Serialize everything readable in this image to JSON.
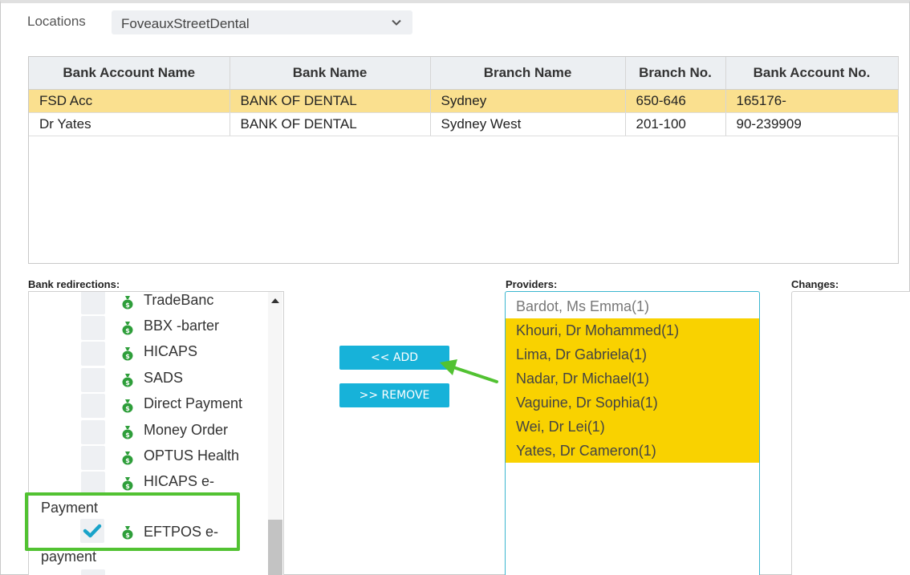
{
  "location": {
    "label": "Locations",
    "value": "FoveauxStreetDental"
  },
  "bank_table": {
    "columns": [
      "Bank Account Name",
      "Bank Name",
      "Branch Name",
      "Branch No.",
      "Bank Account No."
    ],
    "rows": [
      [
        "FSD Acc",
        "BANK OF DENTAL",
        "Sydney",
        "650-646",
        "165176-"
      ],
      [
        "Dr Yates",
        "BANK OF DENTAL",
        "Sydney West",
        "201-100",
        "90-239909"
      ]
    ],
    "selected_row": 0
  },
  "bank_redirections": {
    "label": "Bank redirections:",
    "items": [
      {
        "label": "TradeBanc",
        "icon": "money-bag-icon"
      },
      {
        "label": "BBX -barter",
        "icon": "money-bag-icon"
      },
      {
        "label": "HICAPS",
        "icon": "money-bag-icon"
      },
      {
        "label": "SADS",
        "icon": "money-bag-icon"
      },
      {
        "label": "Direct Payment",
        "icon": "money-bag-icon"
      },
      {
        "label": "Money Order",
        "icon": "money-bag-icon"
      },
      {
        "label": "OPTUS Health",
        "icon": "money-bag-icon"
      },
      {
        "label": "HICAPS e-",
        "icon": "money-bag-icon"
      }
    ],
    "hicaps_wrap": "Payment",
    "checked_item": {
      "label": "EFTPOS e-",
      "wrap": "payment",
      "checked": true
    }
  },
  "buttons": {
    "add": "<< ADD",
    "remove": ">> REMOVE"
  },
  "providers": {
    "label": "Providers:",
    "items": [
      {
        "label": "Bardot, Ms Emma(1)",
        "selected": false
      },
      {
        "label": "Khouri, Dr Mohammed(1)",
        "selected": true
      },
      {
        "label": "Lima, Dr Gabriela(1)",
        "selected": true
      },
      {
        "label": "Nadar, Dr Michael(1)",
        "selected": true
      },
      {
        "label": "Vaguine, Dr Sophia(1)",
        "selected": true
      },
      {
        "label": "Wei, Dr Lei(1)",
        "selected": true
      },
      {
        "label": "Yates, Dr Cameron(1)",
        "selected": true
      }
    ]
  },
  "changes": {
    "label": "Changes:"
  },
  "colors": {
    "accent": "#17b2d9",
    "selected_row": "#fae08f",
    "selected_provider": "#f9d200",
    "highlight": "#52c232",
    "money_icon": "#2e9e3a",
    "check": "#1aa3c9"
  }
}
